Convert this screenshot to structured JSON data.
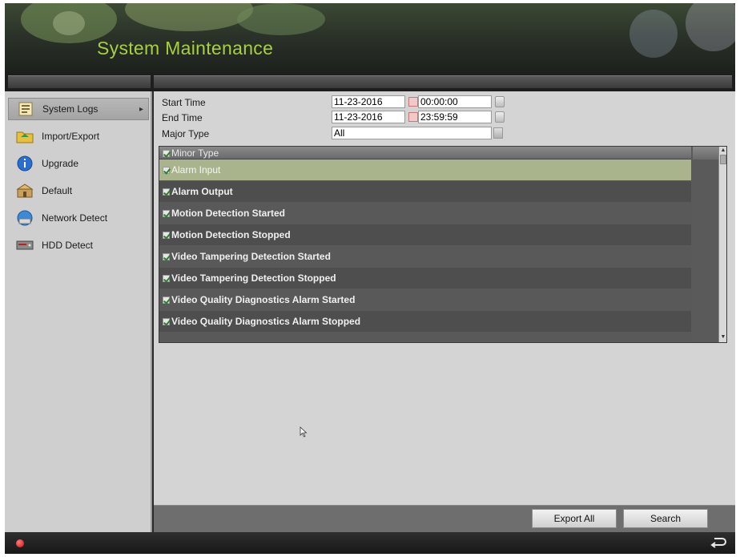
{
  "header": {
    "title": "System Maintenance"
  },
  "sidebar": {
    "items": [
      {
        "label": "System Logs",
        "icon": "log-icon",
        "selected": true
      },
      {
        "label": "Import/Export",
        "icon": "folder-icon",
        "selected": false
      },
      {
        "label": "Upgrade",
        "icon": "info-icon",
        "selected": false
      },
      {
        "label": "Default",
        "icon": "restore-default-icon",
        "selected": false
      },
      {
        "label": "Network Detect",
        "icon": "network-icon",
        "selected": false
      },
      {
        "label": "HDD Detect",
        "icon": "hdd-icon",
        "selected": false
      }
    ]
  },
  "form": {
    "start_time_label": "Start Time",
    "start_date": "11-23-2016",
    "start_time": "00:00:00",
    "end_time_label": "End Time",
    "end_date": "11-23-2016",
    "end_time": "23:59:59",
    "major_type_label": "Major Type",
    "major_type_value": "All"
  },
  "minor_type": {
    "header": "Minor Type",
    "items": [
      {
        "label": "Alarm Input",
        "checked": true,
        "selected": true
      },
      {
        "label": "Alarm Output",
        "checked": true,
        "selected": false
      },
      {
        "label": "Motion Detection Started",
        "checked": true,
        "selected": false
      },
      {
        "label": "Motion Detection Stopped",
        "checked": true,
        "selected": false
      },
      {
        "label": "Video Tampering Detection Started",
        "checked": true,
        "selected": false
      },
      {
        "label": "Video Tampering Detection Stopped",
        "checked": true,
        "selected": false
      },
      {
        "label": "Video Quality Diagnostics Alarm Started",
        "checked": true,
        "selected": false
      },
      {
        "label": "Video Quality Diagnostics Alarm Stopped",
        "checked": true,
        "selected": false
      }
    ]
  },
  "buttons": {
    "export_all": "Export All",
    "search": "Search"
  },
  "colors": {
    "accent_title": "#a6d13a",
    "selected_row": "#a9b48c",
    "status_dot": "#d01010"
  }
}
